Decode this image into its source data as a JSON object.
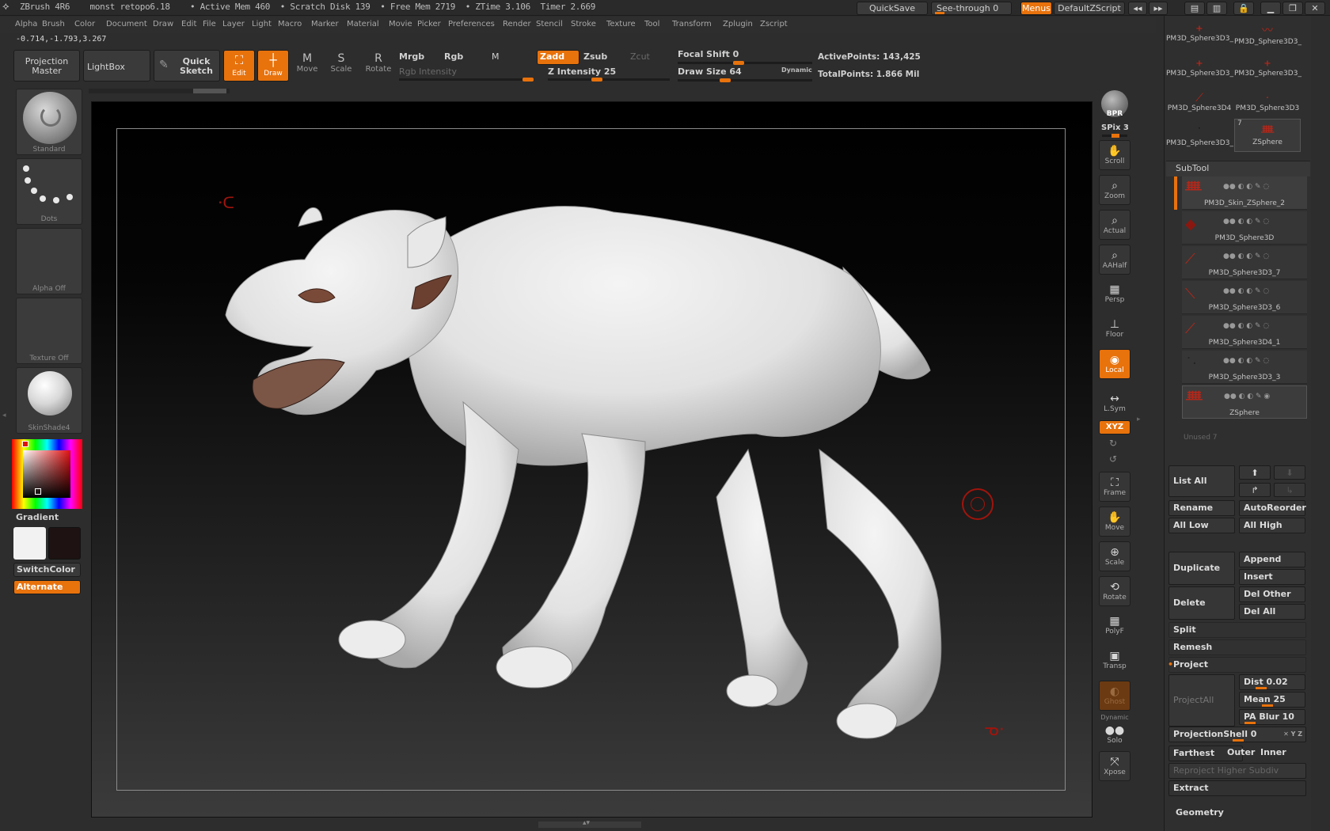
{
  "titlebar": {
    "text": "ZBrush 4R6    monst retopo6.18    • Active Mem 460  • Scratch Disk 139  • Free Mem 2719  • ZTime 3.106  Timer 2.669",
    "quicksave": "QuickSave",
    "see_through": "See-through  0",
    "menus": "Menus",
    "script": "DefaultZScript"
  },
  "menubar": [
    "Alpha",
    "Brush",
    "Color",
    "Document",
    "Draw",
    "Edit",
    "File",
    "Layer",
    "Light",
    "Macro",
    "Marker",
    "Material",
    "Movie",
    "Picker",
    "Preferences",
    "Render",
    "Stencil",
    "Stroke",
    "Texture",
    "Tool",
    "Transform",
    "Zplugin",
    "Zscript"
  ],
  "coords": "-0.714,-1.793,3.267",
  "toolbar": {
    "projection_master": "Projection Master",
    "lightbox": "LightBox",
    "quick_sketch": "Quick Sketch",
    "edit": "Edit",
    "draw": "Draw",
    "move": "Move",
    "scale": "Scale",
    "rotate": "Rotate",
    "mrgb": "Mrgb",
    "rgb": "Rgb",
    "m": "M",
    "zadd": "Zadd",
    "zsub": "Zsub",
    "zcut": "Zcut",
    "rgb_intensity": "Rgb Intensity",
    "z_intensity": "Z Intensity 25",
    "focal_shift": "Focal Shift 0",
    "draw_size": "Draw Size 64",
    "dynamic": "Dynamic",
    "active_points": "ActivePoints: 143,425",
    "total_points": "TotalPoints: 1.866 Mil",
    "focal_shift_level": 0.5,
    "draw_size_level": 0.35,
    "z_intensity_level": 0.25
  },
  "left_panel": {
    "brush": "Standard",
    "stroke": "Dots",
    "alpha": "Alpha  Off",
    "texture": "Texture  Off",
    "material": "SkinShade4",
    "gradient": "Gradient",
    "switchcolor": "SwitchColor",
    "alternate": "Alternate"
  },
  "right_shelf": {
    "bpr": "BPR",
    "spix": "SPix 3",
    "buttons": [
      "Scroll",
      "Zoom",
      "Actual",
      "AAHalf",
      "Persp",
      "Floor",
      "Local",
      "L.Sym",
      "XYZ",
      "Frame",
      "Move",
      "Scale",
      "Rotate",
      "PolyF",
      "Transp",
      "Ghost",
      "Solo",
      "Xpose"
    ],
    "dynamic": "Dynamic"
  },
  "tool_panel": {
    "thumbs": [
      "PM3D_Sphere3D3_",
      "PM3D_Sphere3D3_",
      "PM3D_Sphere3D3_",
      "PM3D_Sphere3D3_",
      "PM3D_Sphere3D4",
      "PM3D_Sphere3D3",
      "PM3D_Sphere3D3_",
      "ZSphere"
    ],
    "zsphere_count": "7",
    "subtool_header": "SubTool",
    "subtools": [
      "PM3D_Skin_ZSphere_2",
      "PM3D_Sphere3D",
      "PM3D_Sphere3D3_7",
      "PM3D_Sphere3D3_6",
      "PM3D_Sphere3D4_1",
      "PM3D_Sphere3D3_3",
      "ZSphere"
    ],
    "unused": "Unused 7",
    "list_all": "List All",
    "rename": "Rename",
    "autoreorder": "AutoReorder",
    "all_low": "All Low",
    "all_high": "All High",
    "duplicate": "Duplicate",
    "append": "Append",
    "insert": "Insert",
    "delete": "Delete",
    "del_other": "Del Other",
    "del_all": "Del All",
    "split": "Split",
    "remesh": "Remesh",
    "project": "Project",
    "projectall": "ProjectAll",
    "dist": "Dist 0.02",
    "mean": "Mean 25",
    "pa_blur": "PA Blur 10",
    "projectionshell": "ProjectionShell 0",
    "farthest": "Farthest",
    "outer": "Outer",
    "inner": "Inner",
    "reproject": "Reproject Higher Subdiv",
    "extract": "Extract",
    "geometry": "Geometry"
  }
}
